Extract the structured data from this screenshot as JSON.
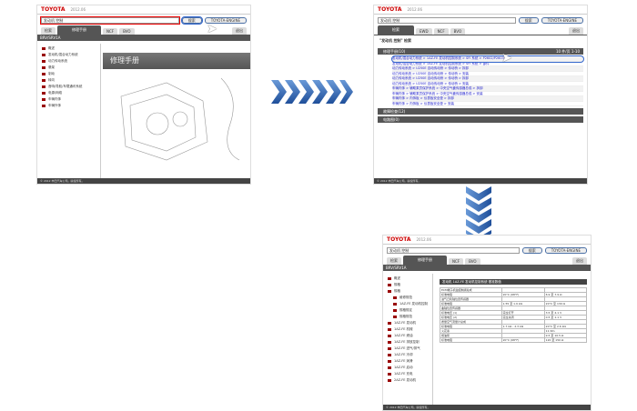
{
  "brand": "TOYOTA",
  "date": "2012.06",
  "search": {
    "value": "发动机 控制",
    "button": "搜索",
    "extra_button": "TOYOTA-ENGINE"
  },
  "tabs": {
    "search": "检索",
    "manual": "修理手册",
    "ewd": "EWD",
    "ncf": "NCF",
    "bvo": "BVO",
    "ext": "退出"
  },
  "sidebar_title": "BRV/SRV1A",
  "sidebar_items": [
    "概述",
    "发动机/混合动力系统",
    "动力传动系统",
    "悬架",
    "制动",
    "转向",
    "音响/导航/车载通讯系统",
    "电源/网络",
    "车辆内饰",
    "车辆外饰"
  ],
  "manual_banner": "修理手册",
  "results": {
    "query_title": "\"发动机 控制\" 检索",
    "sections": [
      "修理手册(10)",
      "故障检查(12)",
      "电路图(0)"
    ],
    "page_info": "10 件/页 1-10",
    "rows": [
      "发动机/混合动力系统 > 1AZ-FE 发动机控制系统 > SFI 系统 > P2602/P2603",
      "发动机/混合动力系统 > 1AZ-FE 发动机控制系统 > SFI 系统 > 部件",
      "动力传动系统 > U250E 自动传动桥 > 传动桥 > 拆卸",
      "动力传动系统 > U250E 自动传动桥 > 传动桥 > 安装",
      "动力传动系统 > U250E 自动传动桥 > 传动桥 > 拆卸",
      "动力传动系统 > U250E 自动传动桥 > 传动桥 > 安装",
      "车辆内饰 > 辅助乘员保护系统 > 中央空气囊传感器总成 > 拆卸",
      "车辆内饰 > 辅助乘员保护系统 > 中央空气囊传感器总成 > 安装",
      "车辆内饰 > 内饰板 > 仪表板安全垫 > 拆卸",
      "车辆内饰 > 内饰板 > 仪表板安全垫 > 安装"
    ]
  },
  "detail": {
    "title": "发动机  1AZ-FE 发动机控制系统  基准数值",
    "tree": [
      "概述",
      "规格",
      "规格",
      "维修规范",
      "1AZ-FE 发动机控制",
      "规格规定",
      "规格规范",
      "1AZ-FE 发动机",
      "1AZ-FE 机械",
      "1AZ-FE 燃油",
      "1AZ-FE 排放控制",
      "1AZ-FE 进气/排气",
      "1AZ-FE 冷却",
      "1AZ-FE 润滑",
      "1AZ-FE 启动",
      "1AZ-FE 充电",
      "2AZ-FE 发动机"
    ],
    "table": [
      [
        "ECM端子机油控制阀总成",
        "",
        ""
      ],
      [
        "标准电阻",
        "20°C (68°F)",
        "6.9 至 7.9 Ω"
      ],
      [
        "进气凸轮轴位置传感器",
        "",
        ""
      ],
      [
        "标准电阻",
        "1.55 至 1.9 kΩ",
        "20°C 至 130 Ω"
      ],
      [
        "曲轴位置传感器",
        "",
        ""
      ],
      [
        "标准电压 (1)",
        "完全打开",
        "3.5 至 4.1 V"
      ],
      [
        "标准电压 (2)",
        "完全关闭",
        "0.5 至 1.1 V"
      ],
      [
        "质量空气流量计总成",
        "",
        ""
      ],
      [
        "标准电阻",
        "1.7 kΩ - 2.3 kΩ",
        "20°C 至 2.6 kΩ"
      ],
      [
        "火花塞",
        "",
        "11 Nm"
      ],
      [
        "燃油泵",
        "",
        "9.5 至 10.5 Ω"
      ],
      [
        "标准电阻",
        "20°C (68°F)",
        "120 至 150 Ω"
      ]
    ]
  },
  "footer": "© 2012 丰田汽车公司。版权所有。"
}
